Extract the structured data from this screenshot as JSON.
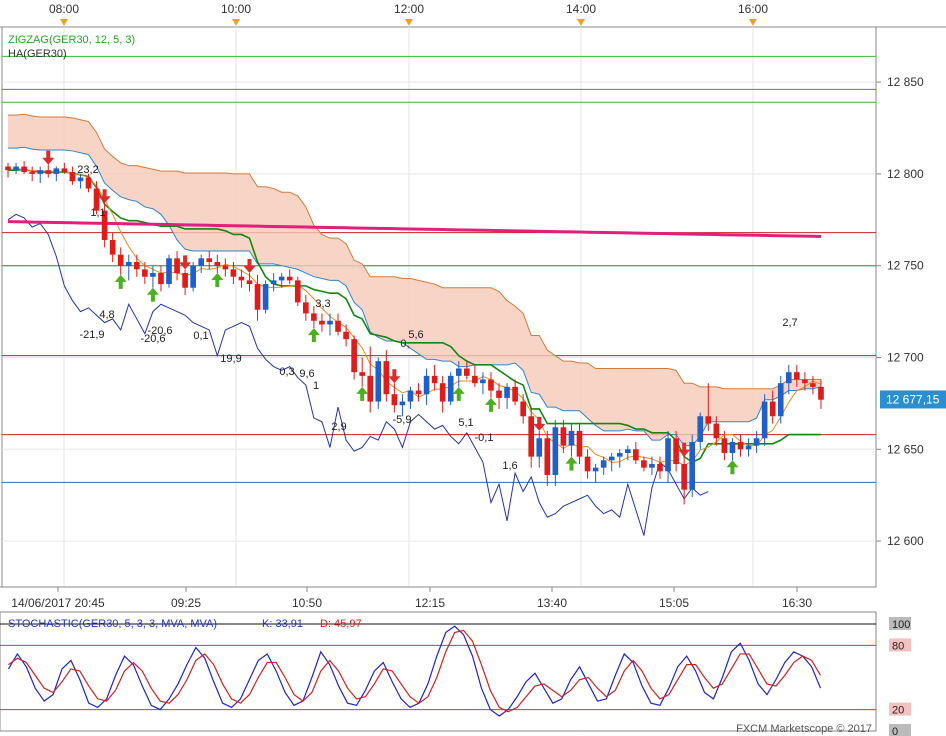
{
  "chart_data": [
    {
      "type": "candlestick",
      "title": "",
      "indicator_labels": [
        "ZIGZAG(GER30, 12, 5, 3)",
        "HA(GER30)"
      ],
      "y_ticks": [
        12850,
        12800,
        12750,
        12700,
        12650,
        12600
      ],
      "y_tick_labels": [
        "12 850",
        "12 800",
        "12 750",
        "12 700",
        "12 650",
        "12 600"
      ],
      "ylim": [
        12575,
        12880
      ],
      "top_time_labels": [
        "08:00",
        "10:00",
        "12:00",
        "14:00",
        "16:00"
      ],
      "bottom_time_labels": [
        "14/06/2017 20:45",
        "09:25",
        "10:50",
        "12:15",
        "13:40",
        "15:05",
        "16:30"
      ],
      "current_price_label": "12 677,15",
      "current_price": 12677.15,
      "grid": true,
      "horizontal_levels": [
        {
          "value": 12864,
          "color": "#33bb33"
        },
        {
          "value": 12846,
          "color": "#6666dd"
        },
        {
          "value": 12839,
          "color": "#33bb33"
        },
        {
          "value": 12768,
          "color": "#cc2222"
        },
        {
          "value": 12750,
          "color": "#2a8a4a"
        },
        {
          "value": 12701,
          "color": "#cc2222"
        },
        {
          "value": 12658,
          "color": "#cc2222"
        },
        {
          "value": 12632,
          "color": "#3366cc"
        }
      ],
      "candles": [
        [
          12804,
          12806,
          12798,
          12802
        ],
        [
          12802,
          12806,
          12800,
          12804
        ],
        [
          12804,
          12807,
          12800,
          12801
        ],
        [
          12801,
          12804,
          12796,
          12800
        ],
        [
          12800,
          12804,
          12795,
          12802
        ],
        [
          12802,
          12805,
          12798,
          12800
        ],
        [
          12800,
          12804,
          12796,
          12803
        ],
        [
          12803,
          12806,
          12800,
          12801
        ],
        [
          12801,
          12804,
          12794,
          12796
        ],
        [
          12796,
          12800,
          12792,
          12798
        ],
        [
          12798,
          12800,
          12790,
          12792
        ],
        [
          12792,
          12796,
          12778,
          12780
        ],
        [
          12780,
          12784,
          12760,
          12764
        ],
        [
          12764,
          12768,
          12752,
          12756
        ],
        [
          12756,
          12760,
          12745,
          12750
        ],
        [
          12750,
          12756,
          12742,
          12752
        ],
        [
          12752,
          12756,
          12744,
          12748
        ],
        [
          12748,
          12752,
          12740,
          12744
        ],
        [
          12744,
          12750,
          12738,
          12746
        ],
        [
          12746,
          12750,
          12736,
          12740
        ],
        [
          12740,
          12756,
          12738,
          12754
        ],
        [
          12754,
          12758,
          12742,
          12746
        ],
        [
          12746,
          12748,
          12734,
          12738
        ],
        [
          12738,
          12752,
          12736,
          12750
        ],
        [
          12750,
          12756,
          12746,
          12754
        ],
        [
          12754,
          12758,
          12748,
          12752
        ],
        [
          12752,
          12756,
          12746,
          12750
        ],
        [
          12750,
          12754,
          12744,
          12748
        ],
        [
          12748,
          12752,
          12740,
          12744
        ],
        [
          12744,
          12748,
          12738,
          12742
        ],
        [
          12742,
          12746,
          12736,
          12740
        ],
        [
          12740,
          12745,
          12720,
          12726
        ],
        [
          12726,
          12742,
          12724,
          12740
        ],
        [
          12740,
          12746,
          12736,
          12742
        ],
        [
          12742,
          12746,
          12738,
          12744
        ],
        [
          12744,
          12748,
          12740,
          12742
        ],
        [
          12742,
          12744,
          12728,
          12730
        ],
        [
          12730,
          12734,
          12720,
          12724
        ],
        [
          12724,
          12728,
          12716,
          12720
        ],
        [
          12720,
          12724,
          12714,
          12718
        ],
        [
          12718,
          12724,
          12712,
          12720
        ],
        [
          12720,
          12724,
          12712,
          12714
        ],
        [
          12714,
          12718,
          12706,
          12710
        ],
        [
          12710,
          12712,
          12688,
          12692
        ],
        [
          12692,
          12700,
          12684,
          12690
        ],
        [
          12690,
          12706,
          12670,
          12676
        ],
        [
          12676,
          12700,
          12672,
          12698
        ],
        [
          12698,
          12704,
          12676,
          12680
        ],
        [
          12680,
          12686,
          12670,
          12674
        ],
        [
          12674,
          12680,
          12668,
          12676
        ],
        [
          12676,
          12684,
          12672,
          12682
        ],
        [
          12682,
          12686,
          12676,
          12680
        ],
        [
          12680,
          12694,
          12674,
          12690
        ],
        [
          12690,
          12696,
          12682,
          12686
        ],
        [
          12686,
          12690,
          12670,
          12676
        ],
        [
          12676,
          12692,
          12674,
          12690
        ],
        [
          12690,
          12698,
          12684,
          12694
        ],
        [
          12694,
          12698,
          12688,
          12690
        ],
        [
          12690,
          12696,
          12684,
          12686
        ],
        [
          12686,
          12692,
          12680,
          12688
        ],
        [
          12688,
          12692,
          12678,
          12682
        ],
        [
          12682,
          12686,
          12672,
          12678
        ],
        [
          12678,
          12686,
          12672,
          12684
        ],
        [
          12684,
          12688,
          12674,
          12676
        ],
        [
          12676,
          12680,
          12664,
          12668
        ],
        [
          12668,
          12672,
          12640,
          12646
        ],
        [
          12646,
          12660,
          12640,
          12656
        ],
        [
          12656,
          12660,
          12630,
          12636
        ],
        [
          12636,
          12666,
          12630,
          12662
        ],
        [
          12662,
          12666,
          12648,
          12652
        ],
        [
          12652,
          12664,
          12646,
          12660
        ],
        [
          12660,
          12664,
          12642,
          12646
        ],
        [
          12646,
          12650,
          12634,
          12638
        ],
        [
          12638,
          12642,
          12632,
          12640
        ],
        [
          12640,
          12646,
          12636,
          12644
        ],
        [
          12644,
          12648,
          12638,
          12646
        ],
        [
          12646,
          12650,
          12640,
          12648
        ],
        [
          12648,
          12652,
          12644,
          12650
        ],
        [
          12650,
          12654,
          12642,
          12644
        ],
        [
          12644,
          12646,
          12638,
          12640
        ],
        [
          12640,
          12646,
          12636,
          12642
        ],
        [
          12642,
          12646,
          12634,
          12638
        ],
        [
          12638,
          12660,
          12632,
          12656
        ],
        [
          12656,
          12660,
          12638,
          12642
        ],
        [
          12642,
          12646,
          12620,
          12628
        ],
        [
          12628,
          12658,
          12624,
          12654
        ],
        [
          12654,
          12670,
          12650,
          12668
        ],
        [
          12668,
          12686,
          12660,
          12664
        ],
        [
          12664,
          12668,
          12652,
          12656
        ],
        [
          12656,
          12660,
          12644,
          12648
        ],
        [
          12648,
          12656,
          12644,
          12654
        ],
        [
          12654,
          12658,
          12646,
          12650
        ],
        [
          12650,
          12656,
          12646,
          12652
        ],
        [
          12652,
          12660,
          12648,
          12656
        ],
        [
          12656,
          12680,
          12652,
          12676
        ],
        [
          12676,
          12682,
          12664,
          12668
        ],
        [
          12668,
          12690,
          12664,
          12686
        ],
        [
          12686,
          12696,
          12680,
          12692
        ],
        [
          12692,
          12696,
          12684,
          12688
        ],
        [
          12688,
          12692,
          12682,
          12686
        ],
        [
          12686,
          12690,
          12680,
          12684
        ],
        [
          12684,
          12688,
          12672,
          12677
        ]
      ],
      "value_labels": [
        "23,2",
        "1,1",
        "4,8",
        "-21,9",
        "-20,6",
        "-20,6",
        "0,1",
        "19,9",
        "3,3",
        "0,3",
        "9,6",
        "1",
        "2,9",
        "5,6",
        "0,",
        "-5,9",
        "5,1",
        "-0,1",
        "1,6",
        "2,7"
      ]
    },
    {
      "type": "line",
      "title": "STOCHASTIC(GER30, 5, 3, 3, MVA, MVA)",
      "k_label": "K: 33,91",
      "d_label": "D: 45,97",
      "y_ticks": [
        100,
        80,
        20,
        0
      ],
      "y_tick_labels": [
        "100",
        "80",
        "20",
        "0"
      ],
      "ylim": [
        0,
        100
      ],
      "series": [
        {
          "name": "K",
          "color": "#2222cc",
          "values": [
            58,
            72,
            60,
            40,
            28,
            34,
            58,
            66,
            48,
            26,
            22,
            30,
            52,
            70,
            62,
            42,
            24,
            20,
            30,
            44,
            62,
            78,
            68,
            46,
            26,
            22,
            30,
            48,
            66,
            72,
            56,
            36,
            24,
            28,
            50,
            74,
            62,
            42,
            26,
            24,
            38,
            56,
            64,
            46,
            30,
            22,
            26,
            44,
            70,
            92,
            98,
            90,
            70,
            40,
            20,
            14,
            20,
            32,
            46,
            54,
            40,
            26,
            30,
            48,
            60,
            44,
            28,
            30,
            52,
            72,
            64,
            42,
            26,
            24,
            40,
            60,
            70,
            56,
            36,
            30,
            50,
            74,
            82,
            66,
            44,
            34,
            48,
            64,
            74,
            70,
            60,
            40
          ]
        },
        {
          "name": "D",
          "color": "#cc2222",
          "values": [
            62,
            68,
            64,
            52,
            40,
            36,
            46,
            58,
            56,
            42,
            30,
            28,
            38,
            56,
            64,
            56,
            40,
            28,
            26,
            34,
            48,
            66,
            72,
            62,
            44,
            30,
            26,
            34,
            50,
            64,
            64,
            50,
            34,
            28,
            36,
            56,
            66,
            56,
            40,
            30,
            32,
            44,
            58,
            56,
            44,
            32,
            26,
            32,
            50,
            74,
            92,
            94,
            84,
            62,
            38,
            22,
            18,
            22,
            32,
            42,
            44,
            38,
            32,
            38,
            48,
            50,
            40,
            32,
            38,
            56,
            66,
            56,
            40,
            30,
            34,
            48,
            62,
            62,
            50,
            40,
            44,
            58,
            72,
            72,
            58,
            44,
            42,
            52,
            64,
            70,
            66,
            52
          ]
        }
      ],
      "copyright": "FXCM Marketscope © 2017"
    }
  ]
}
